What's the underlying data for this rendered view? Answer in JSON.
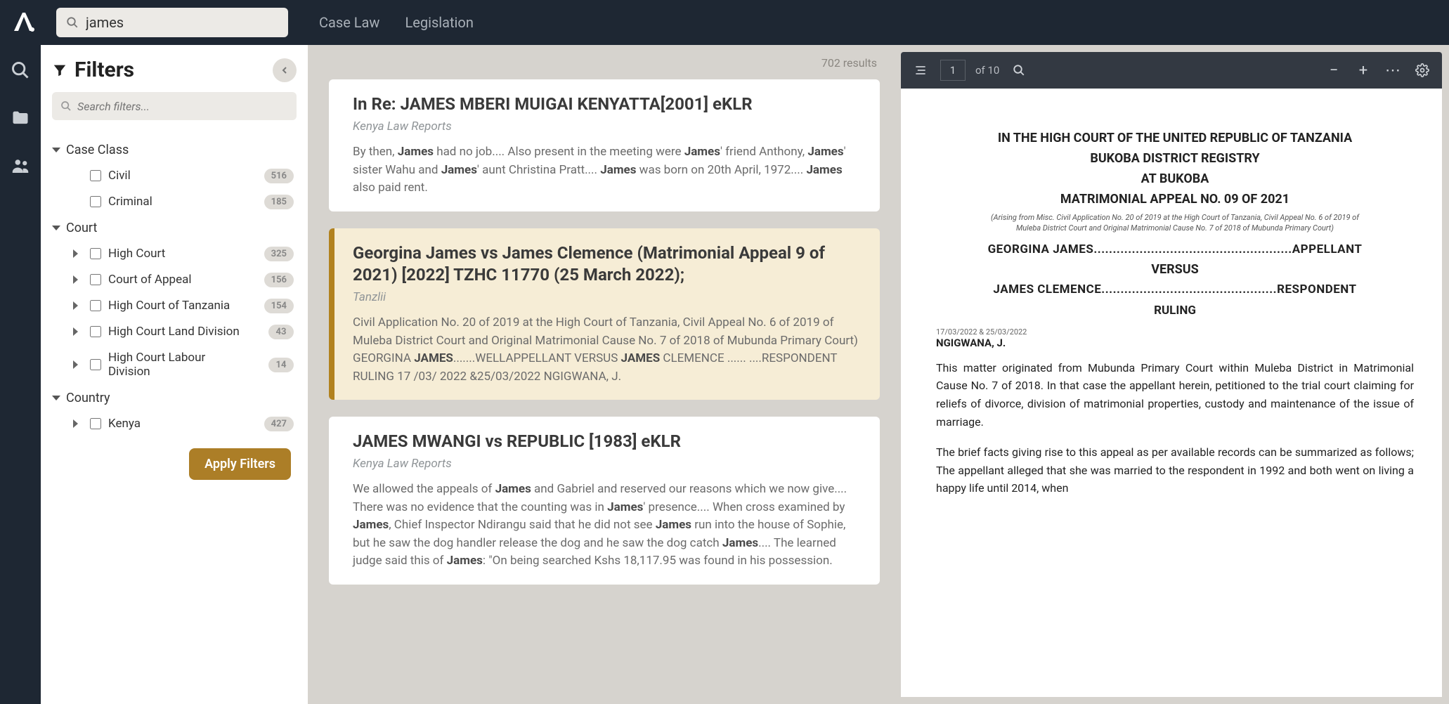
{
  "topbar": {
    "search_value": "james",
    "nav": {
      "case_law": "Case Law",
      "legislation": "Legislation"
    }
  },
  "filters": {
    "title": "Filters",
    "search_placeholder": "Search filters...",
    "apply_label": "Apply Filters",
    "groups": [
      {
        "name": "Case Class",
        "items": [
          {
            "label": "Civil",
            "count": "516",
            "expandable": false
          },
          {
            "label": "Criminal",
            "count": "185",
            "expandable": false
          }
        ]
      },
      {
        "name": "Court",
        "items": [
          {
            "label": "High Court",
            "count": "325",
            "expandable": true
          },
          {
            "label": "Court of Appeal",
            "count": "156",
            "expandable": true
          },
          {
            "label": "High Court of Tanzania",
            "count": "154",
            "expandable": true
          },
          {
            "label": "High Court Land Division",
            "count": "43",
            "expandable": true
          },
          {
            "label": "High Court Labour Division",
            "count": "14",
            "expandable": true
          }
        ]
      },
      {
        "name": "Country",
        "items": [
          {
            "label": "Kenya",
            "count": "427",
            "expandable": true
          }
        ]
      }
    ]
  },
  "results": {
    "count_label": "702 results",
    "items": [
      {
        "title": "In Re: JAMES MBERI MUIGAI KENYATTA[2001] eKLR",
        "source": "Kenya Law Reports",
        "snippet_html": "By then, <b>James</b> had no job.... Also present in the meeting were <b>James</b>' friend Anthony, <b>James</b>' sister Wahu and <b>James</b>' aunt Christina Pratt.... <b>James</b> was born on 20th April, 1972.... <b>James</b> also paid rent.",
        "selected": false
      },
      {
        "title": "Georgina James vs James Clemence (Matrimonial Appeal 9 of 2021) [2022] TZHC 11770 (25 March 2022);",
        "source": "Tanzlii",
        "snippet_html": "Civil Application No. 20 of 2019 at the High Court of Tanzania, Civil Appeal No. 6 of 2019 of Muleba District Court and Original Matrimonial Cause No. 7 of 2018 of Mubunda Primary Court) GEORGINA <b>JAMES</b>.......WELLAPPELLANT VERSUS <b>JAMES</b> CLEMENCE ...... ....RESPONDENT RULING 17 /03/ 2022 &25/03/2022 NGIGWANA, J.",
        "selected": true
      },
      {
        "title": "JAMES MWANGI vs REPUBLIC [1983] eKLR",
        "source": "Kenya Law Reports",
        "snippet_html": "We allowed the appeals of <b>James</b> and Gabriel and reserved our reasons which we now give.... There was no evidence that the counting was in <b>James</b>' presence.... When cross examined by <b>James</b>, Chief Inspector Ndirangu said that he did not see <b>James</b> run into the house of Sophie, but he saw the dog handler release the dog and he saw the dog catch <b>James</b>.... The learned judge said this of <b>James</b>: \"On being searched Kshs 18,117.95 was found in his possession.",
        "selected": false
      }
    ]
  },
  "doc": {
    "toolbar": {
      "page_current": "1",
      "page_total": "of 10"
    },
    "header": {
      "court": "IN THE HIGH COURT OF THE UNITED REPUBLIC OF TANZANIA",
      "registry": "BUKOBA DISTRICT REGISTRY",
      "location": "AT BUKOBA",
      "case_no": "MATRIMONIAL APPEAL NO. 09 OF 2021",
      "arising": "(Arising from Misc. Civil Application No. 20 of 2019 at the High Court of Tanzania, Civil Appeal No. 6 of 2019 of Muleba District Court and Original Matrimonial Cause No. 7 of 2018 of Mubunda Primary Court)",
      "appellant_line": "GEORGINA JAMES....................................................APPELLANT",
      "versus": "VERSUS",
      "respondent_line": "JAMES CLEMENCE..............................................RESPONDENT",
      "ruling": "RULING",
      "dates": "17/03/2022 & 25/03/2022",
      "judge": "NGIGWANA, J."
    },
    "body": {
      "p1": "This matter originated from Mubunda Primary Court within Muleba District in Matrimonial Cause No. 7 of 2018. In that case the appellant herein, petitioned to the trial court claiming for reliefs of divorce, division of matrimonial properties, custody and maintenance of the issue of marriage.",
      "p2": "The brief facts giving rise to this appeal as per available records can be summarized as follows; The appellant alleged that she was married to the respondent in 1992 and both went on living a happy life until 2014, when"
    }
  }
}
